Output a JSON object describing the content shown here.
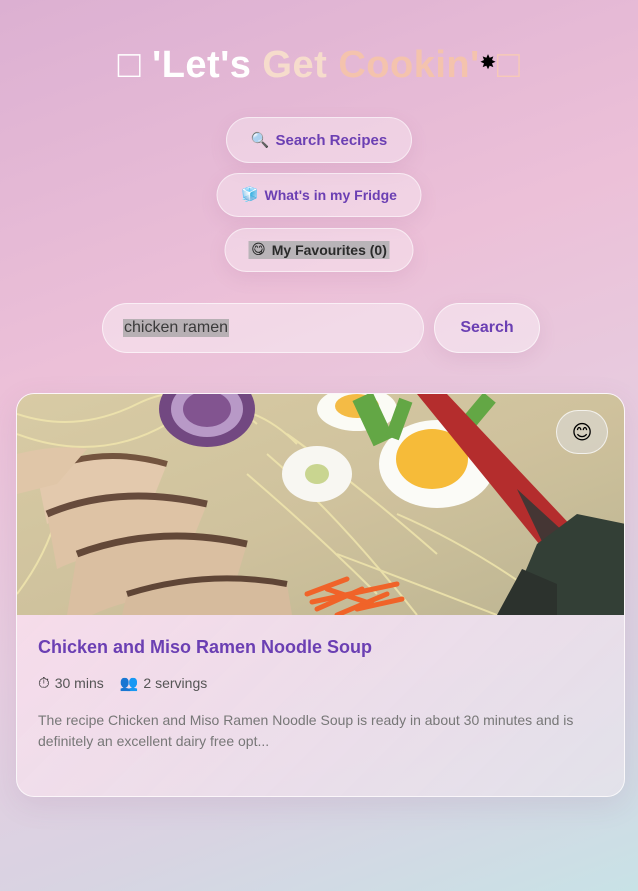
{
  "header": {
    "box_left": "□",
    "word1": " 'Let's ",
    "word2": "Get ",
    "word3": "Cookin'",
    "burst": "✸",
    "box_right": "□"
  },
  "nav": {
    "search": {
      "icon": "🔍",
      "icon_name": "magnifier-icon",
      "label": "Search Recipes"
    },
    "fridge": {
      "icon": "🧊",
      "icon_name": "ice-cube-icon",
      "label": "What's in my Fridge"
    },
    "favourites": {
      "icon": "😋",
      "icon_name": "yum-face-icon",
      "label": "My Favourites (0)"
    }
  },
  "search": {
    "value": "chicken ramen",
    "button_label": "Search"
  },
  "results": [
    {
      "title": "Chicken and Miso Ramen Noodle Soup",
      "time": "30 mins",
      "servings": "2 servings",
      "time_icon": "⏱",
      "servings_icon": "👥",
      "favourite_icon": "😊",
      "description": "The recipe Chicken and Miso Ramen Noodle Soup is ready in about 30 minutes and is definitely an excellent dairy free opt..."
    }
  ],
  "colors": {
    "accent": "#6b3fb3",
    "title_white": "#ffffff",
    "title_peach": "#f4c3ad"
  }
}
